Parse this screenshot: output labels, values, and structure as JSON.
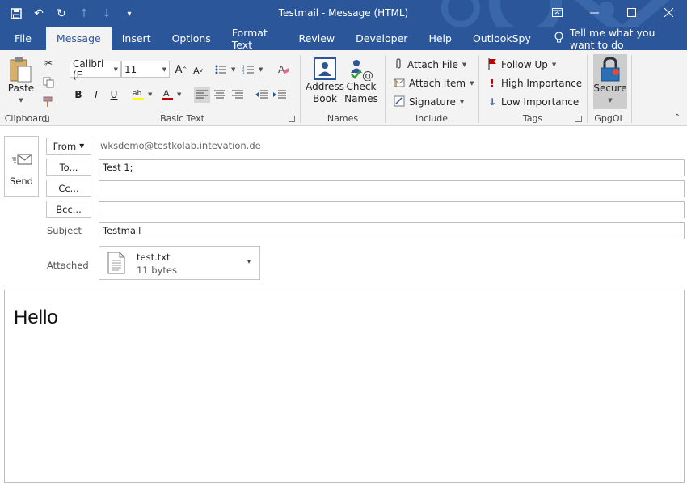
{
  "window": {
    "title": "Testmail  -  Message (HTML)"
  },
  "tabs": [
    {
      "label": "File"
    },
    {
      "label": "Message"
    },
    {
      "label": "Insert"
    },
    {
      "label": "Options"
    },
    {
      "label": "Format Text"
    },
    {
      "label": "Review"
    },
    {
      "label": "Developer"
    },
    {
      "label": "Help"
    },
    {
      "label": "OutlookSpy"
    }
  ],
  "tell_me": "Tell me what you want to do",
  "ribbon": {
    "clipboard": {
      "paste": "Paste",
      "label": "Clipboard"
    },
    "basic_text": {
      "font": "Calibri (E",
      "size": "11",
      "label": "Basic Text",
      "bold": "B",
      "italic": "I",
      "underline": "U"
    },
    "names": {
      "address_book_1": "Address",
      "address_book_2": "Book",
      "check_names_1": "Check",
      "check_names_2": "Names",
      "label": "Names"
    },
    "include": {
      "attach_file": "Attach File",
      "attach_item": "Attach Item",
      "signature": "Signature",
      "label": "Include"
    },
    "tags": {
      "follow_up": "Follow Up",
      "high_importance": "High Importance",
      "low_importance": "Low Importance",
      "label": "Tags"
    },
    "gpgol": {
      "secure": "Secure",
      "label": "GpgOL"
    }
  },
  "compose": {
    "send": "Send",
    "from_button": "From",
    "from_address": "wksdemo@testkolab.intevation.de",
    "to_button": "To...",
    "to_value": "Test 1;",
    "cc_button": "Cc...",
    "cc_value": "",
    "bcc_button": "Bcc...",
    "bcc_value": "",
    "subject_label": "Subject",
    "subject_value": "Testmail",
    "attached_label": "Attached",
    "attachment": {
      "name": "test.txt",
      "size": "11 bytes"
    },
    "body": "Hello"
  },
  "colors": {
    "accent": "#2b579a",
    "ribbon_bg": "#f3f3f3",
    "high_importance": "#c00000",
    "low_importance": "#2b579a"
  }
}
